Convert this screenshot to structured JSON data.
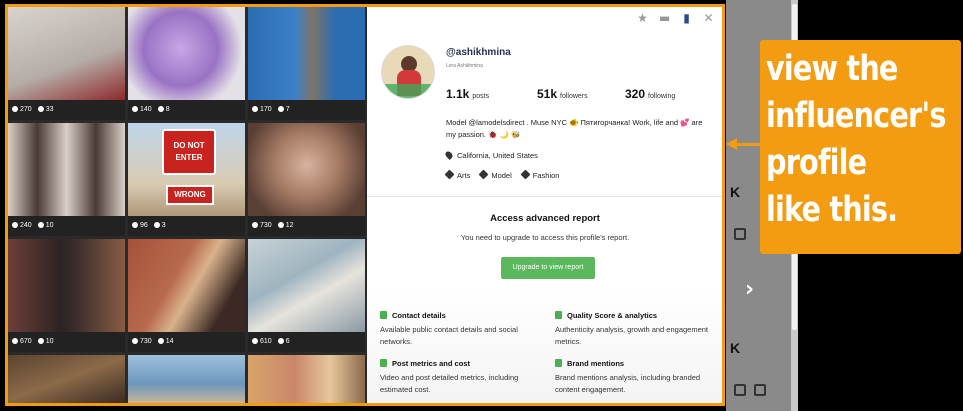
{
  "colors": {
    "accent": "#f39c12",
    "button": "#5cb85c",
    "username": "#2a2f5a"
  },
  "grid": {
    "tiles": [
      {
        "likes": "270",
        "comments": "33",
        "bg": "#c9c3bd"
      },
      {
        "likes": "140",
        "comments": "8",
        "bg": "#a986c9"
      },
      {
        "likes": "170",
        "comments": "7",
        "bg": "#2f6fb8"
      },
      {
        "likes": "240",
        "comments": "10",
        "bg": "#6b5a52"
      },
      {
        "likes": "96",
        "comments": "3",
        "bg": "#b9a48a"
      },
      {
        "likes": "730",
        "comments": "12",
        "bg": "#8c6a58"
      },
      {
        "likes": "670",
        "comments": "10",
        "bg": "#4a3a36"
      },
      {
        "likes": "730",
        "comments": "14",
        "bg": "#9b5a44"
      },
      {
        "likes": "610",
        "comments": "6",
        "bg": "#a9b8bf"
      },
      {
        "likes": "",
        "comments": "",
        "bg": "#6e5336"
      },
      {
        "likes": "",
        "comments": "",
        "bg": "#7aa0c2"
      },
      {
        "likes": "",
        "comments": "",
        "bg": "#c59a6a"
      }
    ],
    "sign": {
      "line1": "DO NOT",
      "line2": "ENTER",
      "line3": "WRONG"
    }
  },
  "profile": {
    "username": "@ashikhmina",
    "full_name": "Lera Ashikhmina",
    "posts_value": "1.1k",
    "posts_label": "posts",
    "followers_value": "51k",
    "followers_label": "followers",
    "following_value": "320",
    "following_label": "following",
    "bio": "Model @lamodelsdirect . Muse NYC 🐠 Пятигорчанка! Work, life and 💕 are my passion. 🐞 🌙 🐝",
    "location": "California, United States",
    "tags": [
      "Arts",
      "Model",
      "Fashion"
    ]
  },
  "toolbar": {
    "icons": [
      "star-icon",
      "comment-icon",
      "bookmark-icon",
      "close-icon"
    ]
  },
  "report": {
    "title": "Access advanced report",
    "subtitle": "You need to upgrade to access this profile's report.",
    "button_label": "Upgrade to view report",
    "features": [
      {
        "title": "Contact details",
        "desc": "Available public contact details and social networks."
      },
      {
        "title": "Quality Score & analytics",
        "desc": "Authenticity analysis, growth and engagement metrics."
      },
      {
        "title": "Post metrics and cost",
        "desc": "Video and post detailed metrics, including estimated cost."
      },
      {
        "title": "Brand mentions",
        "desc": "Brand mentions analysis, including branded content engagement."
      }
    ]
  },
  "callout": {
    "text": "view the\ninfluencer's\nprofile\nlike this."
  },
  "background": {
    "letters": [
      "K",
      "K",
      "K"
    ]
  }
}
